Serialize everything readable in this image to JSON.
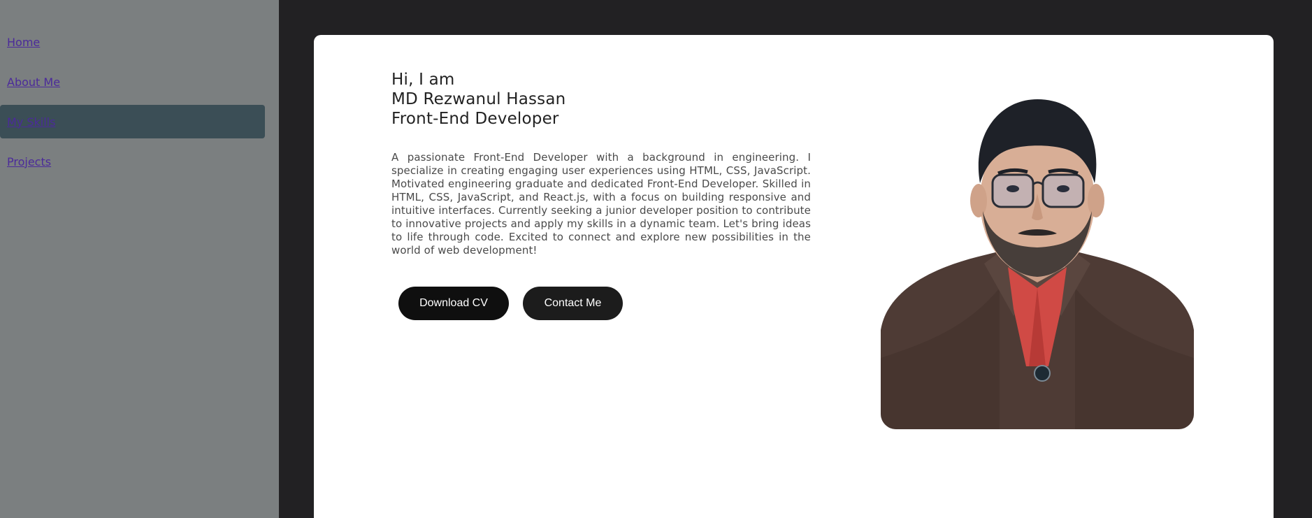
{
  "sidebar": {
    "items": [
      {
        "label": "Home",
        "active": false
      },
      {
        "label": "About Me",
        "active": false
      },
      {
        "label": "My Skills",
        "active": true
      },
      {
        "label": "Projects",
        "active": false
      }
    ]
  },
  "hero": {
    "greeting": "Hi, I am",
    "name": "MD Rezwanul Hassan",
    "role": "Front-End Developer",
    "bio": "A passionate Front-End Developer with a background in engineering. I specialize in creating engaging user experiences using HTML, CSS, JavaScript. Motivated engineering graduate and dedicated Front-End Developer. Skilled in HTML, CSS, JavaScript, and React.js, with a focus on building responsive and intuitive interfaces. Currently seeking a junior developer position to contribute to innovative projects and apply my skills in a dynamic team. Let's bring ideas to life through code. Excited to connect and explore new possibilities in the world of web development!",
    "download_cv_label": "Download CV",
    "contact_label": "Contact Me"
  },
  "colors": {
    "page_bg": "#222123",
    "sidebar_bg": "#7b7f80",
    "active_item_bg": "#3b4e56",
    "link": "#4b2a9a",
    "card_bg": "#ffffff",
    "button_bg": "#0f0f0f"
  }
}
